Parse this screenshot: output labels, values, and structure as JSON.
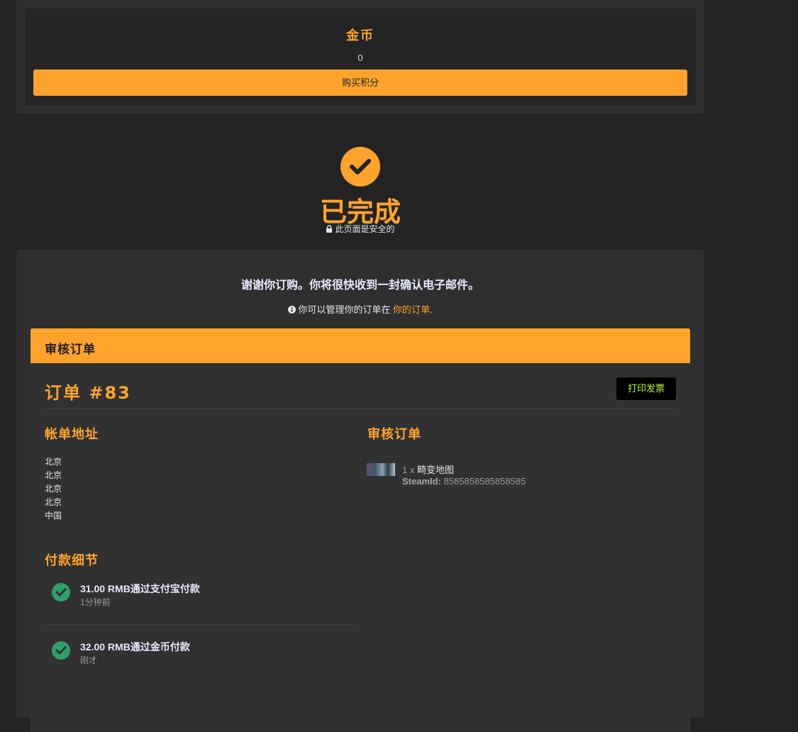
{
  "coins": {
    "title": "金币",
    "value": "0",
    "buy_label": "购买积分"
  },
  "status": {
    "title": "已完成",
    "secure_note": "此页面是安全的"
  },
  "thanks": {
    "message": "谢谢你订购。你将很快收到一封确认电子邮件。",
    "manage_prefix": "你可以管理你的订单在",
    "manage_link": "你的订单",
    "manage_suffix": "."
  },
  "review": {
    "bar_title": "审核订单"
  },
  "order": {
    "number": "订单 #83",
    "print_label": "打印发票",
    "billing": {
      "title": "帐单地址",
      "lines": [
        "北京",
        "北京",
        "北京",
        "北京",
        "中国"
      ]
    },
    "review_title": "审核订单",
    "items": [
      {
        "qty": "1 x",
        "name": "畸变地图",
        "meta_label": "SteamId:",
        "meta_value": "8585858585858585"
      }
    ],
    "payment": {
      "title": "付款细节",
      "entries": [
        {
          "amount": "31.00 RMB通过支付宝付款",
          "time": "1分钟前"
        },
        {
          "amount": "32.00 RMB通过金币付款",
          "time": "刚才"
        }
      ]
    }
  },
  "colors": {
    "accent": "#ffa32d",
    "success": "#2e9e6b",
    "print_text": "#b8ff3d"
  }
}
